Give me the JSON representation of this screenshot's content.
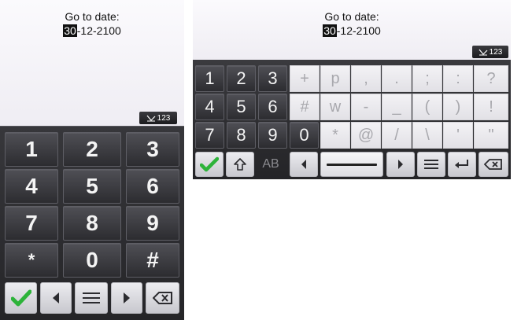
{
  "prompt": "Go to date:",
  "date": {
    "selected": "30",
    "rest": "-12-2100"
  },
  "mode_indicator": "123",
  "colors": {
    "confirm": "#2db33a",
    "keypad_dark": "#3b3b40",
    "keypad_light": "#ececf0"
  },
  "numeric_keypad": {
    "rows": [
      [
        "1",
        "2",
        "3"
      ],
      [
        "4",
        "5",
        "6"
      ],
      [
        "7",
        "8",
        "9"
      ],
      [
        "*",
        "0",
        "#"
      ]
    ],
    "bottom_icons": [
      "check-icon",
      "left-arrow-icon",
      "menu-icon",
      "right-arrow-icon",
      "backspace-icon"
    ]
  },
  "full_keyboard": {
    "digit_rows": [
      [
        "1",
        "2",
        "3"
      ],
      [
        "4",
        "5",
        "6"
      ],
      [
        "7",
        "8",
        "9"
      ],
      [
        "0"
      ]
    ],
    "symbol_rows": [
      [
        "+",
        "p",
        ",",
        ".",
        ";",
        ":",
        "?"
      ],
      [
        "#",
        "w",
        "-",
        "_",
        "(",
        ")",
        "!"
      ],
      [
        "*",
        "@",
        "/",
        "\\",
        "'",
        "\""
      ]
    ],
    "case_label": "AB",
    "bottom_icons": [
      "check-icon",
      "shift-icon",
      "case-toggle",
      "left-arrow-icon",
      "space-bar",
      "right-arrow-icon",
      "menu-icon",
      "enter-icon",
      "backspace-icon"
    ]
  }
}
